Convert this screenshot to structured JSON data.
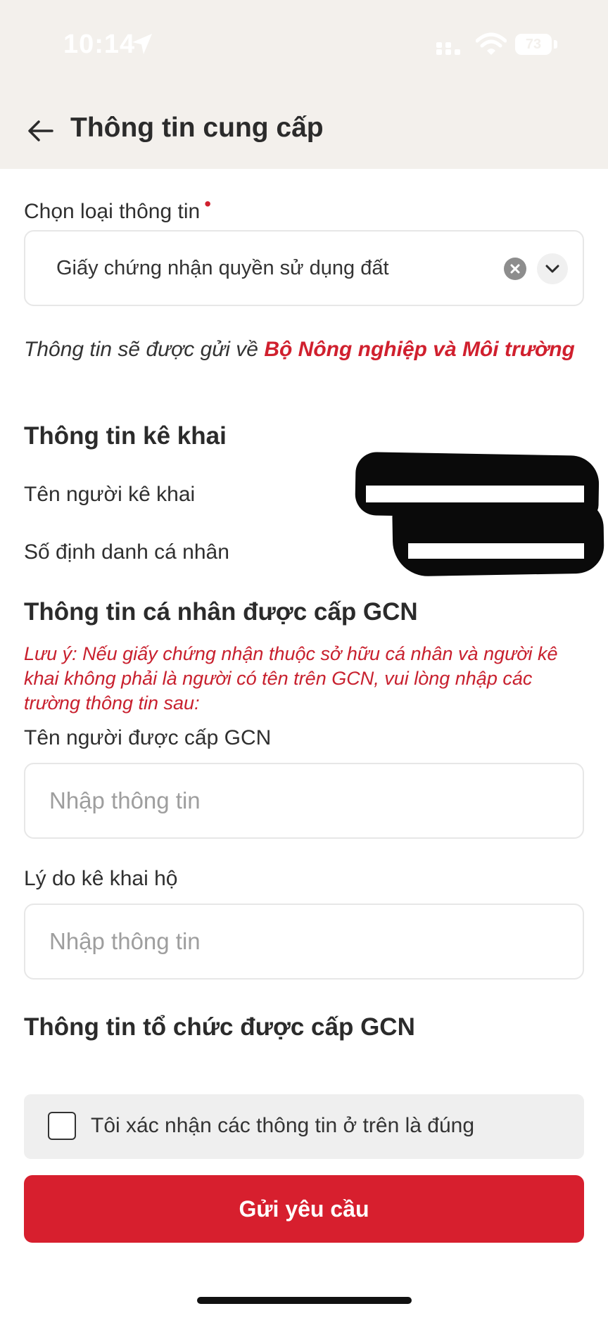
{
  "status_bar": {
    "time": "10:14",
    "battery": "73"
  },
  "header": {
    "title": "Thông tin cung cấp"
  },
  "form": {
    "type_label": "Chọn loại thông tin",
    "type_value": "Giấy chứng nhận quyền sử dụng đất",
    "notice_prefix": "Thông tin sẽ được gửi về ",
    "notice_agency": "Bộ Nông nghiệp và Môi trường"
  },
  "declarant": {
    "section_title": "Thông tin kê khai",
    "name_label": "Tên người kê khai",
    "id_label": "Số định danh cá nhân"
  },
  "individual": {
    "section_title": "Thông tin cá nhân được cấp GCN",
    "note": "Lưu ý: Nếu giấy chứng nhận thuộc sở hữu cá nhân và người kê khai không phải là người có tên trên GCN, vui lòng nhập các trường thông tin sau:",
    "holder_label": "Tên người được cấp GCN",
    "holder_placeholder": "Nhập thông tin",
    "reason_label": "Lý do kê khai hộ",
    "reason_placeholder": "Nhập thông tin"
  },
  "organization": {
    "section_title": "Thông tin tổ chức được cấp GCN"
  },
  "confirm": {
    "label": "Tôi xác nhận các thông tin ở trên là đúng"
  },
  "submit": {
    "label": "Gửi yêu cầu"
  },
  "colors": {
    "accent": "#d71f2e",
    "header_bg": "#f3f0ec"
  }
}
